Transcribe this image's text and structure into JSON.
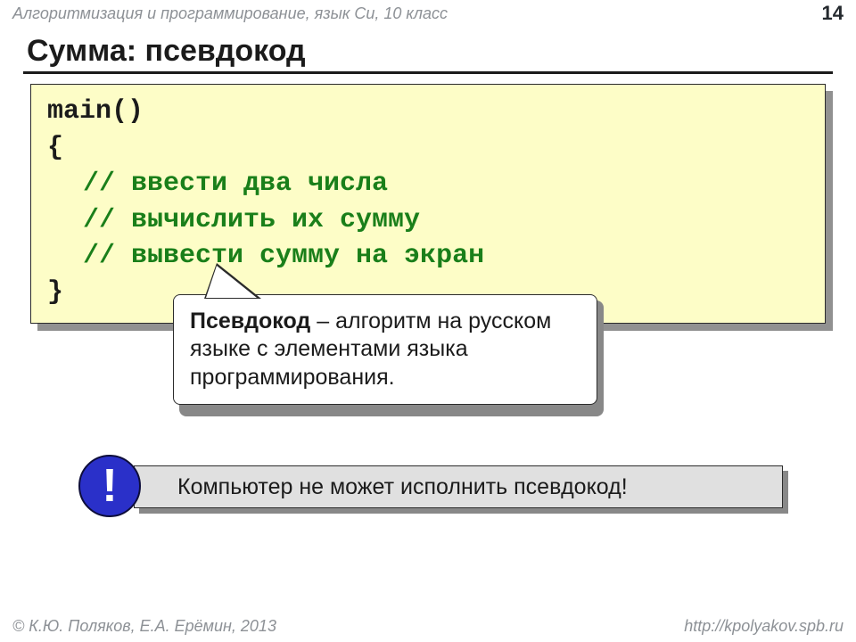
{
  "header": {
    "course": "Алгоритмизация и программирование, язык Си, 10 класс",
    "page": "14"
  },
  "title": "Сумма: псевдокод",
  "code": {
    "l1": "main()",
    "l2": "{",
    "c1": "// ввести два числа",
    "c2": "// вычислить их сумму",
    "c3": "// вывести сумму на экран",
    "l3": "}"
  },
  "callout": {
    "term": "Псевдокод",
    "rest": " – алгоритм на русском языке с элементами языка программирования."
  },
  "alert": {
    "badge": "!",
    "text": "Компьютер не может исполнить псевдокод!"
  },
  "footer": {
    "authors": "© К.Ю. Поляков, Е.А. Ерёмин, 2013",
    "url": "http://kpolyakov.spb.ru"
  }
}
